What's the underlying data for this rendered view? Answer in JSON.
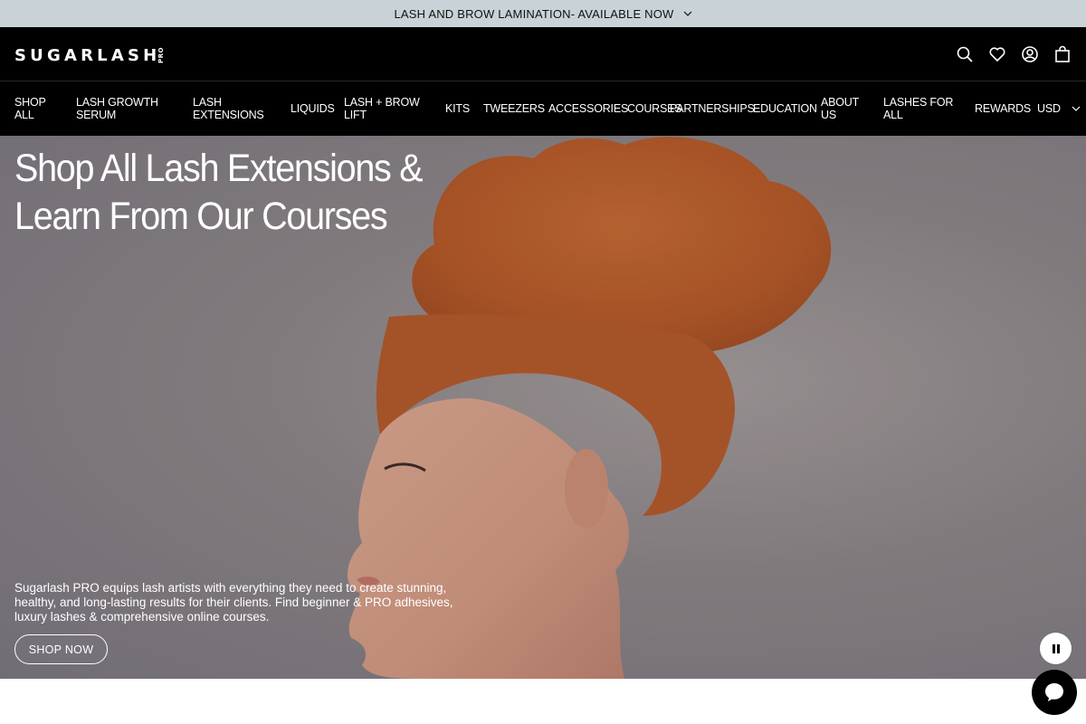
{
  "announcement": {
    "text": "LASH AND BROW LAMINATION- AVAILABLE NOW"
  },
  "header": {
    "logo": {
      "word": "SUGARLASH",
      "sub": "PRO"
    },
    "icons": [
      "search-icon",
      "heart-icon",
      "account-icon",
      "bag-icon"
    ]
  },
  "nav": {
    "items": [
      {
        "label": "SHOP ALL"
      },
      {
        "label": "LASH GROWTH SERUM"
      },
      {
        "label": "LASH EXTENSIONS"
      },
      {
        "label": "LIQUIDS"
      },
      {
        "label": "LASH + BROW LIFT"
      },
      {
        "label": "KITS"
      },
      {
        "label": "TWEEZERS"
      },
      {
        "label": "ACCESSORIES"
      },
      {
        "label": "COURSES"
      },
      {
        "label": "PARTNERSHIPS"
      },
      {
        "label": "EDUCATION"
      },
      {
        "label": "ABOUT US"
      },
      {
        "label": "LASHES FOR ALL"
      },
      {
        "label": "REWARDS"
      }
    ],
    "currency": "USD"
  },
  "hero": {
    "title": "Shop All Lash Extensions & Learn From Our Courses",
    "description": "Sugarlash PRO equips lash artists with everything they need to create stunning, healthy, and long-lasting results for their clients. Find beginner & PRO adhesives, luxury lashes & comprehensive online courses.",
    "button": "SHOP NOW",
    "controls": {
      "pause_icon": "pause-icon"
    }
  },
  "chat": {
    "icon": "chat-icon"
  },
  "colors": {
    "announce_bg": "#c9d3d7",
    "header_bg": "#000000",
    "hair": "#c2642d",
    "skin": "#d9a48c"
  }
}
